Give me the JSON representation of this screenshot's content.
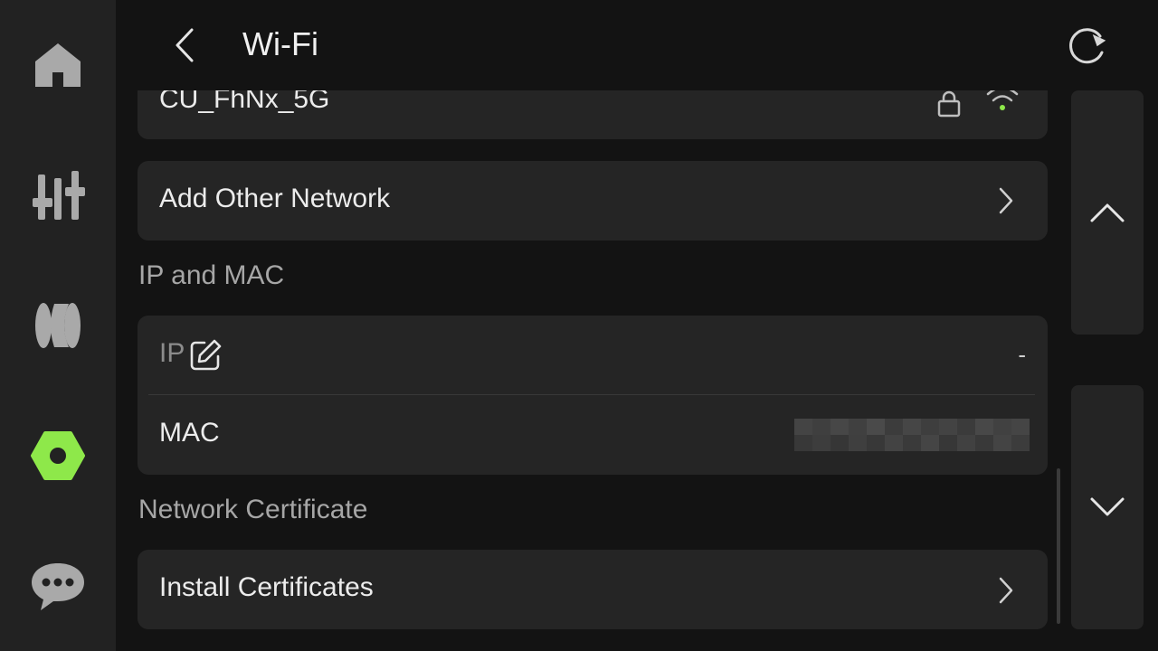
{
  "header": {
    "title": "Wi-Fi"
  },
  "sidebar": {
    "items": [
      {
        "icon": "home-icon"
      },
      {
        "icon": "sliders-icon"
      },
      {
        "icon": "filament-spool-icon"
      },
      {
        "icon": "gear-hex-icon",
        "active": true
      },
      {
        "icon": "chat-icon"
      }
    ]
  },
  "networks": [
    {
      "ssid": "CU_FhNx_5G",
      "secured": true,
      "signal": "strong"
    }
  ],
  "add_other_network": {
    "label": "Add Other Network"
  },
  "ip_mac": {
    "section_title": "IP and MAC",
    "ip_label": "IP",
    "ip_value": "-",
    "mac_label": "MAC"
  },
  "certificate": {
    "section_title": "Network Certificate",
    "install_label": "Install Certificates"
  },
  "colors": {
    "accent": "#8ee84a",
    "background": "#131313",
    "card": "#252525",
    "sidebar": "#222222"
  }
}
